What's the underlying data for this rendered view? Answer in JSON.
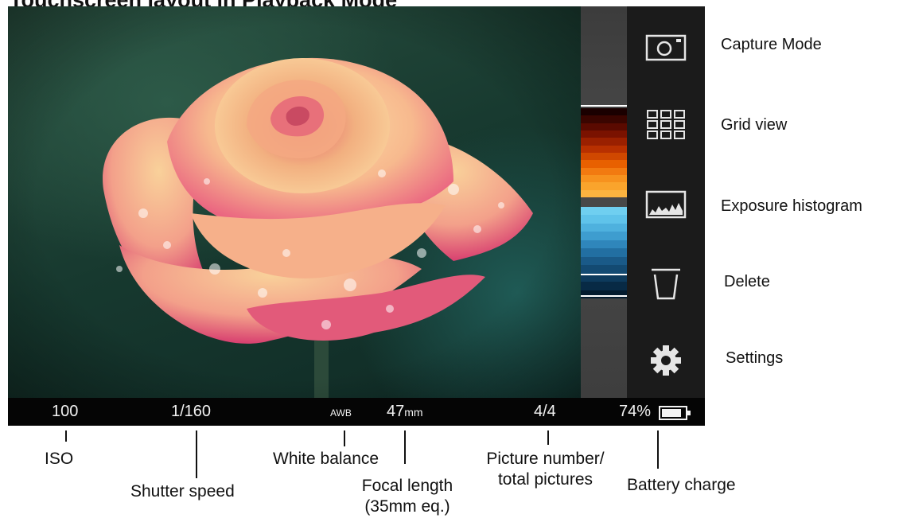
{
  "title": "Touchscreen layout in Playback Mode",
  "status_bar": {
    "iso": "100",
    "shutter": "1/160",
    "wb": "AWB",
    "focal_value": "47",
    "focal_unit": "mm",
    "picture_count": "4/4",
    "battery": "74%"
  },
  "side_buttons": [
    {
      "label": "Capture Mode",
      "icon": "camera-icon"
    },
    {
      "label": "Grid view",
      "icon": "grid-icon"
    },
    {
      "label": "Exposure histogram",
      "icon": "histogram-icon"
    },
    {
      "label": "Delete",
      "icon": "trash-icon"
    },
    {
      "label": "Settings",
      "icon": "gear-icon"
    }
  ],
  "bottom_labels": {
    "iso": "ISO",
    "shutter": "Shutter speed",
    "wb": "White balance",
    "focal_line1": "Focal length",
    "focal_line2": "(35mm eq.)",
    "picture_line1": "Picture number/",
    "picture_line2": "total pictures",
    "battery": "Battery charge"
  },
  "histogram": {
    "warm_colors": [
      "#1a0000",
      "#3a0500",
      "#5a0a00",
      "#7a1200",
      "#9a2000",
      "#b83000",
      "#d04800",
      "#e86000",
      "#f27a10",
      "#f7921e",
      "#faa42c",
      "#fcb440"
    ],
    "cool_colors": [
      "#6fcff0",
      "#5fc3ea",
      "#4eb1de",
      "#3e9dcf",
      "#2f86bb",
      "#226fa2",
      "#1a5a88",
      "#134a72",
      "#0d3a5c",
      "#082a45",
      "#041b2e"
    ]
  }
}
